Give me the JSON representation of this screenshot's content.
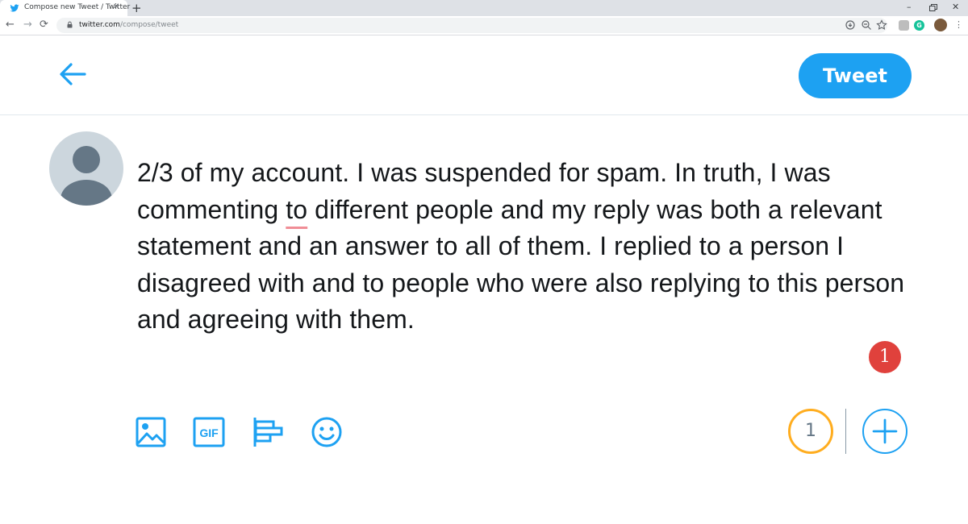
{
  "browser": {
    "tab_title": "Compose new Tweet / Twitter",
    "tab_close": "✕",
    "new_tab": "+",
    "url_host": "twitter.com",
    "url_path": "/compose/tweet",
    "window_minimize": "–",
    "window_close": "✕",
    "menu": "⋮",
    "extension_g": "G"
  },
  "compose": {
    "tweet_button": "Tweet",
    "text_before": "2/3 of my account. I was suspended for spam. In truth, I was commenting ",
    "text_misspelled": "to",
    "text_after": " different people and my reply was both a relevant statement and an answer to all of them. I replied to a person I disagreed with and to people who were also replying to this person and agreeing with them.",
    "notification_count": "1",
    "thread_count": "1"
  },
  "colors": {
    "brand": "#1da1f2",
    "counter_ring": "#ffad1f",
    "badge": "#e0413c"
  },
  "icons": [
    "twitter-bird-icon",
    "back-arrow-icon",
    "media-icon",
    "gif-icon",
    "poll-icon",
    "emoji-icon",
    "add-icon"
  ]
}
